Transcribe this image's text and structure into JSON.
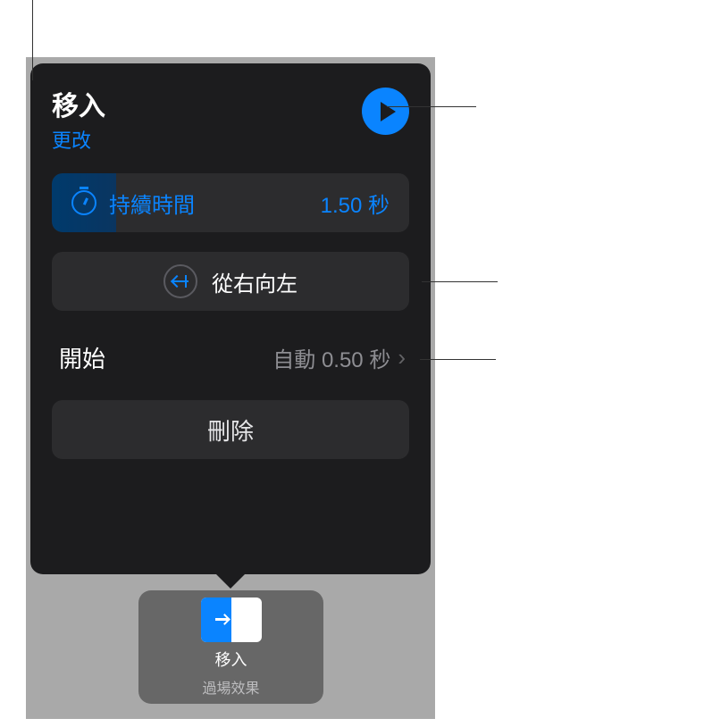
{
  "popover": {
    "title": "移入",
    "change_link": "更改",
    "duration": {
      "label": "持續時間",
      "value": "1.50 秒"
    },
    "direction": {
      "label": "從右向左"
    },
    "start": {
      "label": "開始",
      "value": "自動 0.50 秒"
    },
    "delete_label": "刪除"
  },
  "transition_chip": {
    "title": "移入",
    "subtitle": "過場效果"
  }
}
